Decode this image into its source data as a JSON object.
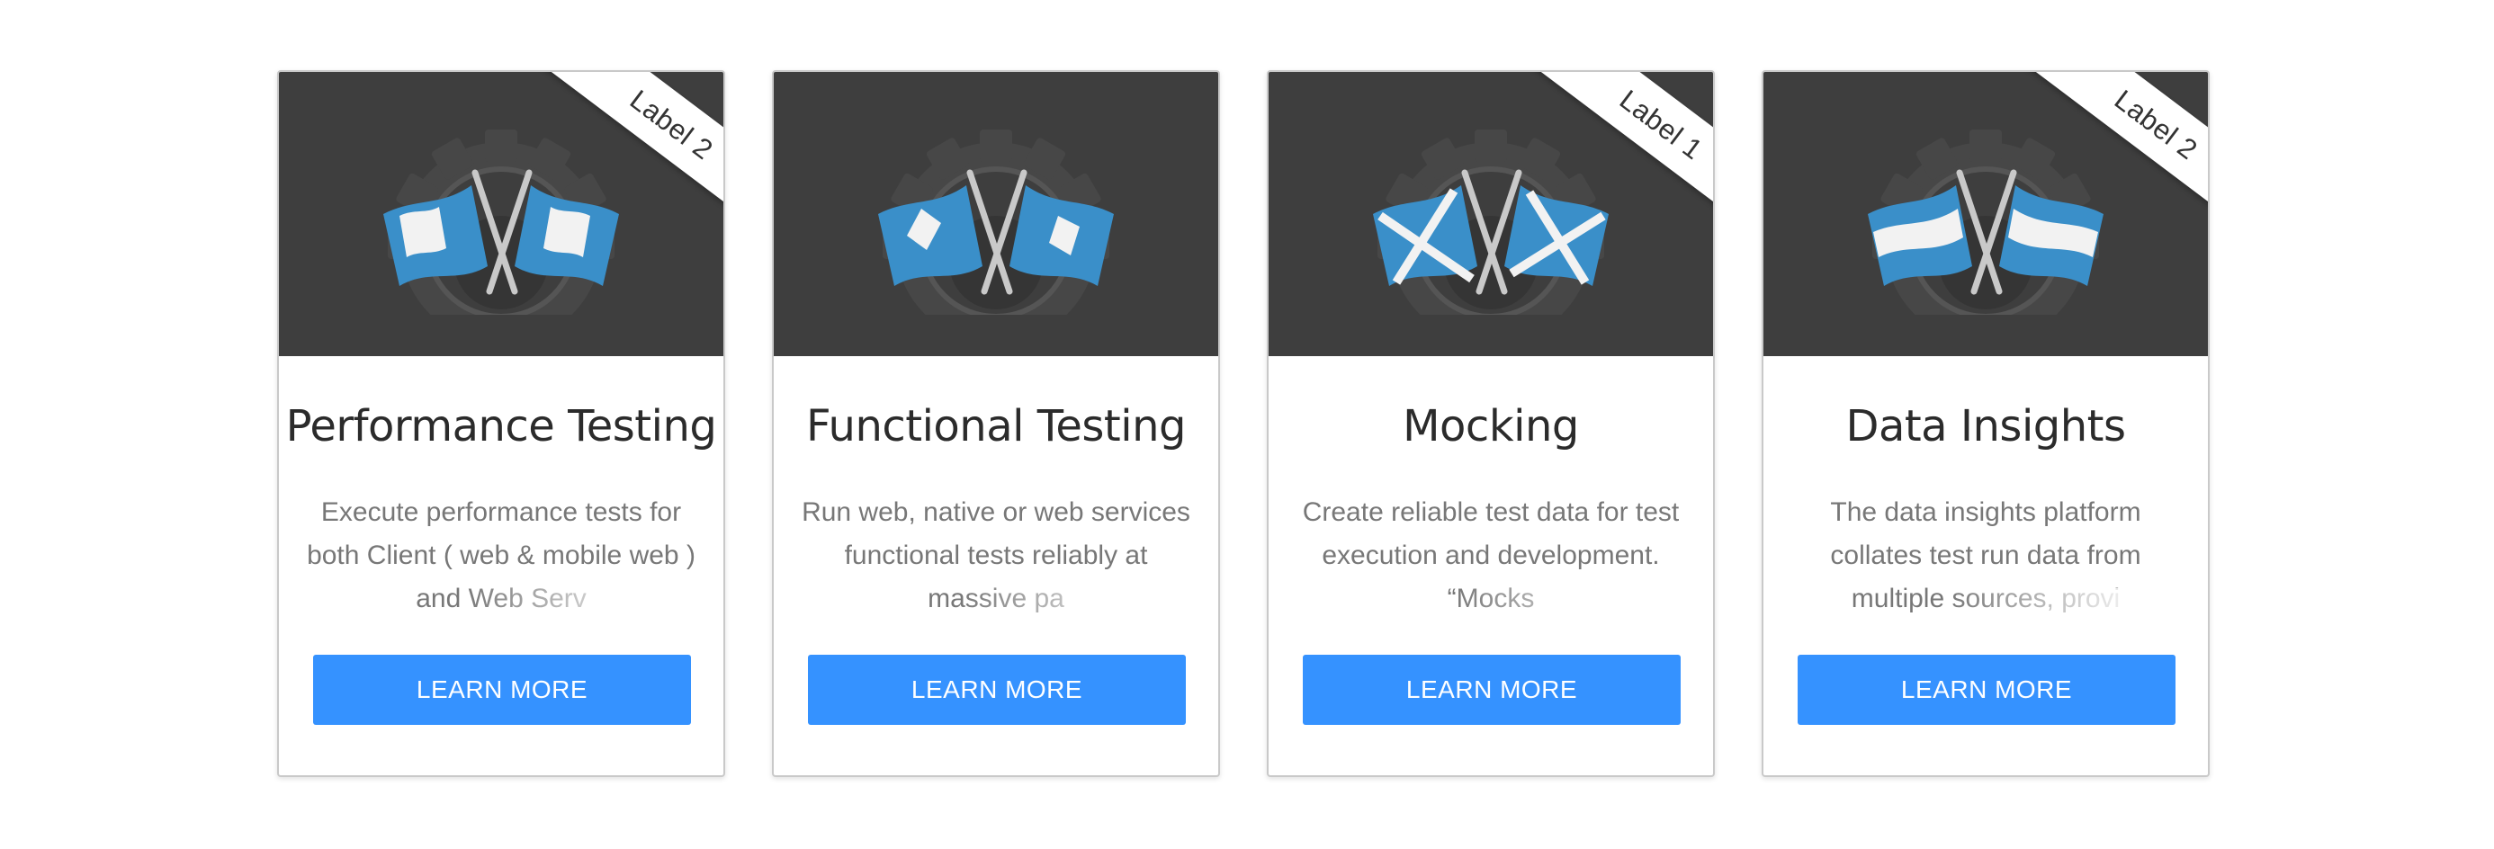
{
  "cards": [
    {
      "title": "Performance Testing",
      "description": "Execute performance tests for both Client ( web & mobile web ) and Web Serv",
      "ribbon": "Label 2",
      "button": "LEARN MORE",
      "flag_style": "square-flags"
    },
    {
      "title": "Functional Testing",
      "description": "Run web, native or web services functional tests reliably at massive pa",
      "ribbon": "",
      "button": "LEARN MORE",
      "flag_style": "diamond-flags"
    },
    {
      "title": "Mocking",
      "description": "Create reliable test data for test execution and development. “Mocks",
      "ribbon": "Label 1",
      "button": "LEARN MORE",
      "flag_style": "cross-flags"
    },
    {
      "title": "Data Insights",
      "description": "The data insights platform collates test run data from multiple sources, provi",
      "ribbon": "Label 2",
      "button": "LEARN MORE",
      "flag_style": "striped-flags"
    }
  ],
  "colors": {
    "button": "#3592ff",
    "card_header": "#3e3e3e",
    "flag": "#3a8fc9",
    "title": "#2b2b2b",
    "description": "#777777"
  }
}
